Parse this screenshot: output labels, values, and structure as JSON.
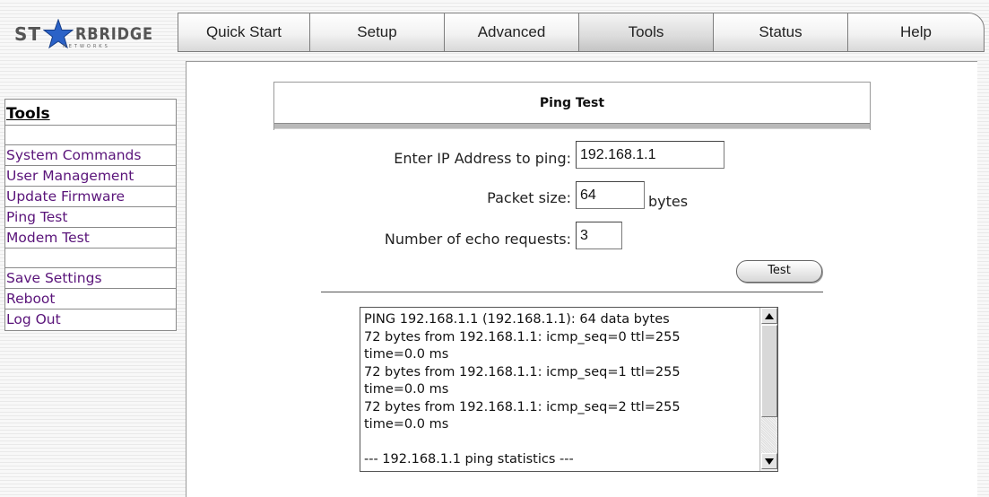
{
  "brand": {
    "text_left": "ST",
    "text_right": "RBRIDGE",
    "tagline": "NETWORKS"
  },
  "nav": {
    "tabs": [
      {
        "label": "Quick Start"
      },
      {
        "label": "Setup"
      },
      {
        "label": "Advanced"
      },
      {
        "label": "Tools",
        "active": true
      },
      {
        "label": "Status"
      },
      {
        "label": "Help"
      }
    ]
  },
  "sidebar": {
    "title": "Tools",
    "group1": [
      "System Commands",
      "User Management",
      "Update Firmware",
      "Ping Test",
      "Modem Test"
    ],
    "group2": [
      "Save Settings",
      "Reboot",
      "Log Out"
    ]
  },
  "ping": {
    "title": "Ping Test",
    "ip_label": "Enter IP Address to ping:",
    "ip_value": "192.168.1.1",
    "size_label": "Packet size:",
    "size_value": "64",
    "size_unit": "bytes",
    "count_label": "Number of echo requests:",
    "count_value": "3",
    "test_button": "Test",
    "output": "PING 192.168.1.1 (192.168.1.1): 64 data bytes\n72 bytes from 192.168.1.1: icmp_seq=0 ttl=255\ntime=0.0 ms\n72 bytes from 192.168.1.1: icmp_seq=1 ttl=255\ntime=0.0 ms\n72 bytes from 192.168.1.1: icmp_seq=2 ttl=255\ntime=0.0 ms\n\n--- 192.168.1.1 ping statistics ---"
  }
}
